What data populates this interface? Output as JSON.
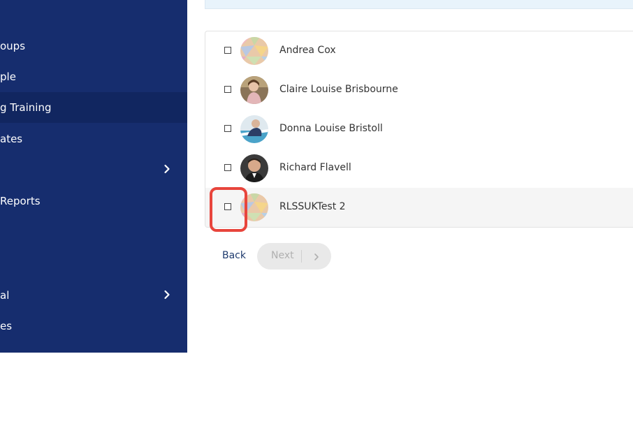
{
  "sidebar": {
    "items": [
      {
        "label": "oups",
        "has_chevron": false,
        "active": false
      },
      {
        "label": "ple",
        "has_chevron": false,
        "active": false
      },
      {
        "label": "g Training",
        "has_chevron": false,
        "active": true
      },
      {
        "label": "ates",
        "has_chevron": false,
        "active": false
      },
      {
        "label": "",
        "has_chevron": true,
        "active": false
      },
      {
        "label": "Reports",
        "has_chevron": false,
        "active": false
      },
      {
        "label": "al",
        "has_chevron": true,
        "active": false
      },
      {
        "label": "es",
        "has_chevron": false,
        "active": false
      }
    ]
  },
  "people": [
    {
      "name": "Andrea Cox",
      "avatar": "placeholder"
    },
    {
      "name": "Claire Louise Brisbourne",
      "avatar": "photo"
    },
    {
      "name": "Donna Louise Bristoll",
      "avatar": "photo"
    },
    {
      "name": "Richard Flavell",
      "avatar": "photo"
    },
    {
      "name": "RLSSUKTest 2",
      "avatar": "placeholder"
    }
  ],
  "actions": {
    "back_label": "Back",
    "next_label": "Next"
  },
  "colors": {
    "sidebar_bg": "#162d6e",
    "sidebar_active": "#112660",
    "highlight_ring": "#e8453c",
    "link": "#1f3b6e"
  }
}
